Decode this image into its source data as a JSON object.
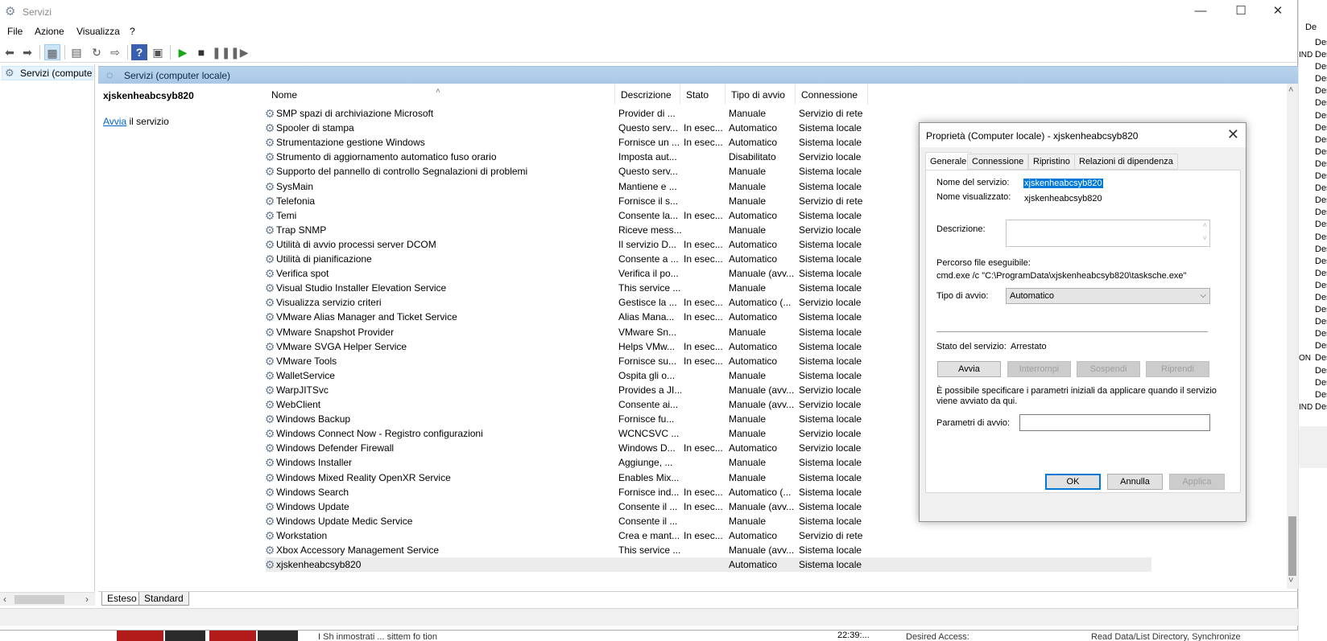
{
  "window": {
    "title": "Servizi",
    "minimize": "—",
    "maximize": "☐",
    "close": "✕"
  },
  "menu": [
    "File",
    "Azione",
    "Visualizza",
    "?"
  ],
  "tree": {
    "root": "Servizi (computer locale)"
  },
  "band_title": "Servizi (computer locale)",
  "extended": {
    "service_name": "xjskenheabcsyb820",
    "start_link": "Avvia",
    "start_suffix": " il servizio"
  },
  "columns": [
    "Nome",
    "Descrizione",
    "Stato",
    "Tipo di avvio",
    "Connessione"
  ],
  "services": [
    [
      "SMP spazi di archiviazione Microsoft",
      "Provider di ...",
      "",
      "Manuale",
      "Servizio di rete"
    ],
    [
      "Spooler di stampa",
      "Questo serv...",
      "In esec...",
      "Automatico",
      "Sistema locale"
    ],
    [
      "Strumentazione gestione Windows",
      "Fornisce un ...",
      "In esec...",
      "Automatico",
      "Sistema locale"
    ],
    [
      "Strumento di aggiornamento automatico fuso orario",
      "Imposta aut...",
      "",
      "Disabilitato",
      "Servizio locale"
    ],
    [
      "Supporto del pannello di controllo Segnalazioni di problemi",
      "Questo serv...",
      "",
      "Manuale",
      "Sistema locale"
    ],
    [
      "SysMain",
      "Mantiene e ...",
      "",
      "Manuale",
      "Sistema locale"
    ],
    [
      "Telefonia",
      "Fornisce il s...",
      "",
      "Manuale",
      "Servizio di rete"
    ],
    [
      "Temi",
      "Consente la...",
      "In esec...",
      "Automatico",
      "Sistema locale"
    ],
    [
      "Trap SNMP",
      "Riceve mess...",
      "",
      "Manuale",
      "Servizio locale"
    ],
    [
      "Utilità di avvio processi server DCOM",
      "Il servizio D...",
      "In esec...",
      "Automatico",
      "Sistema locale"
    ],
    [
      "Utilità di pianificazione",
      "Consente a ...",
      "In esec...",
      "Automatico",
      "Sistema locale"
    ],
    [
      "Verifica spot",
      "Verifica il po...",
      "",
      "Manuale (avv...",
      "Sistema locale"
    ],
    [
      "Visual Studio Installer Elevation Service",
      "This service ...",
      "",
      "Manuale",
      "Sistema locale"
    ],
    [
      "Visualizza servizio criteri",
      "Gestisce la ...",
      "In esec...",
      "Automatico (...",
      "Servizio locale"
    ],
    [
      "VMware Alias Manager and Ticket Service",
      "Alias Mana...",
      "In esec...",
      "Automatico",
      "Sistema locale"
    ],
    [
      "VMware Snapshot Provider",
      "VMware Sn...",
      "",
      "Manuale",
      "Sistema locale"
    ],
    [
      "VMware SVGA Helper Service",
      "Helps VMw...",
      "In esec...",
      "Automatico",
      "Sistema locale"
    ],
    [
      "VMware Tools",
      "Fornisce su...",
      "In esec...",
      "Automatico",
      "Sistema locale"
    ],
    [
      "WalletService",
      "Ospita gli o...",
      "",
      "Manuale",
      "Sistema locale"
    ],
    [
      "WarpJITSvc",
      "Provides a JI...",
      "",
      "Manuale (avv...",
      "Servizio locale"
    ],
    [
      "WebClient",
      "Consente ai...",
      "",
      "Manuale (avv...",
      "Servizio locale"
    ],
    [
      "Windows Backup",
      "Fornisce fu...",
      "",
      "Manuale",
      "Sistema locale"
    ],
    [
      "Windows Connect Now - Registro configurazioni",
      "WCNCSVC ...",
      "",
      "Manuale",
      "Servizio locale"
    ],
    [
      "Windows Defender Firewall",
      "Windows D...",
      "In esec...",
      "Automatico",
      "Servizio locale"
    ],
    [
      "Windows Installer",
      "Aggiunge, ...",
      "",
      "Manuale",
      "Sistema locale"
    ],
    [
      "Windows Mixed Reality OpenXR Service",
      "Enables Mix...",
      "",
      "Manuale",
      "Sistema locale"
    ],
    [
      "Windows Search",
      "Fornisce ind...",
      "In esec...",
      "Automatico (...",
      "Sistema locale"
    ],
    [
      "Windows Update",
      "Consente il ...",
      "In esec...",
      "Manuale (avv...",
      "Sistema locale"
    ],
    [
      "Windows Update Medic Service",
      "Consente il ...",
      "",
      "Manuale",
      "Sistema locale"
    ],
    [
      "Workstation",
      "Crea e mant...",
      "In esec...",
      "Automatico",
      "Servizio di rete"
    ],
    [
      "Xbox Accessory Management Service",
      "This service ...",
      "",
      "Manuale (avv...",
      "Sistema locale"
    ],
    [
      "xjskenheabcsyb820",
      "",
      "",
      "Automatico",
      "Sistema locale"
    ]
  ],
  "selected_row": 31,
  "bottom_tabs": [
    "Esteso",
    "Standard"
  ],
  "dialog": {
    "title": "Proprietà (Computer locale) - xjskenheabcsyb820",
    "close": "✕",
    "tabs": [
      "Generale",
      "Connessione",
      "Ripristino",
      "Relazioni di dipendenza"
    ],
    "service_name_label": "Nome del servizio:",
    "service_name_value": "xjskenheabcsyb820",
    "display_name_label": "Nome visualizzato:",
    "display_name_value": "xjskenheabcsyb820",
    "description_label": "Descrizione:",
    "path_label": "Percorso file eseguibile:",
    "path_value": "cmd.exe /c \"C:\\ProgramData\\xjskenheabcsyb820\\tasksche.exe\"",
    "startup_type_label": "Tipo di avvio:",
    "startup_type_value": "Automatico",
    "status_label": "Stato del servizio:",
    "status_value": "Arrestato",
    "btn_start": "Avvia",
    "btn_stop": "Interrompi",
    "btn_pause": "Sospendi",
    "btn_resume": "Riprendi",
    "hint_line1": "È possibile specificare i parametri iniziali da applicare quando il servizio",
    "hint_line2": "viene avviato da qui.",
    "params_label": "Parametri di avvio:",
    "btn_ok": "OK",
    "btn_cancel": "Annulla",
    "btn_apply": "Applica"
  },
  "background": {
    "right_header": "De",
    "right_col": "Des",
    "right_edge_1": "IND",
    "right_edge_2": "ON",
    "right_edge_3": "IND",
    "bottom_time": "22:39:...",
    "bottom_text_1": "Desired Access:",
    "bottom_text_2": "Read Data/List Directory, Synchronize",
    "bottom_text_3": "I Sh inmostrati ... sittem fo tion"
  },
  "colors": {
    "accent": "#0078d7",
    "band": "#b8d3ec",
    "selected_row": "#ececec",
    "link": "#0066cc"
  },
  "icons": {
    "app": "gear-icon",
    "service": "gear-icon",
    "back": "arrow-left-icon",
    "forward": "arrow-right-icon",
    "play": "play-icon",
    "stop": "stop-icon",
    "pause": "pause-icon",
    "restart": "restart-icon"
  }
}
